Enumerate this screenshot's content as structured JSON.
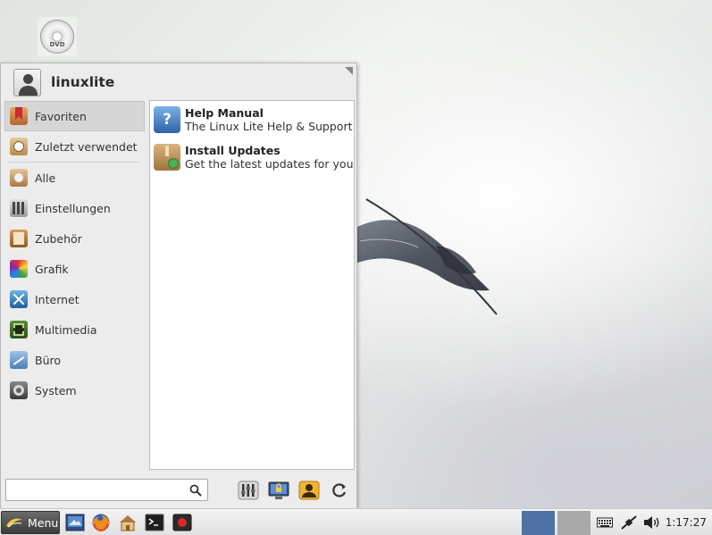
{
  "desktop": {
    "dvd_label": "DVD"
  },
  "menu": {
    "username": "linuxlite",
    "categories": [
      {
        "label": "Favoriten",
        "icon": "bookmark-icon",
        "selected": true
      },
      {
        "label": "Zuletzt verwendet",
        "icon": "recent-icon",
        "selected": false
      },
      {
        "label": "Alle",
        "icon": "all-apps-icon",
        "selected": false
      },
      {
        "label": "Einstellungen",
        "icon": "settings-icon",
        "selected": false
      },
      {
        "label": "Zubehör",
        "icon": "accessories-icon",
        "selected": false
      },
      {
        "label": "Grafik",
        "icon": "graphics-icon",
        "selected": false
      },
      {
        "label": "Internet",
        "icon": "internet-icon",
        "selected": false
      },
      {
        "label": "Multimedia",
        "icon": "multimedia-icon",
        "selected": false
      },
      {
        "label": "Büro",
        "icon": "office-icon",
        "selected": false
      },
      {
        "label": "System",
        "icon": "system-icon",
        "selected": false
      }
    ],
    "apps": [
      {
        "title": "Help Manual",
        "subtitle": "The Linux Lite Help & Support ...",
        "icon": "help-icon"
      },
      {
        "title": "Install Updates",
        "subtitle": "Get the latest updates for you...",
        "icon": "package-update-icon"
      }
    ],
    "search": {
      "value": "",
      "placeholder": ""
    },
    "bottom_buttons": [
      "settings-manager-icon",
      "lock-screen-icon",
      "switch-user-icon",
      "logout-icon"
    ]
  },
  "taskbar": {
    "menu_label": "Menu",
    "launchers": [
      "desktop-icon",
      "firefox-icon",
      "file-manager-icon",
      "terminal-icon",
      "screen-recorder-icon"
    ],
    "workspaces": [
      {
        "active": true
      },
      {
        "active": false
      }
    ],
    "tray": [
      "keyboard-icon",
      "network-icon",
      "volume-icon"
    ],
    "clock": "1:17:27"
  },
  "colors": {
    "workspace_active": "#4f72a6",
    "workspace_inactive": "#a9a9a9",
    "menu_button": "#4a4a4a"
  }
}
